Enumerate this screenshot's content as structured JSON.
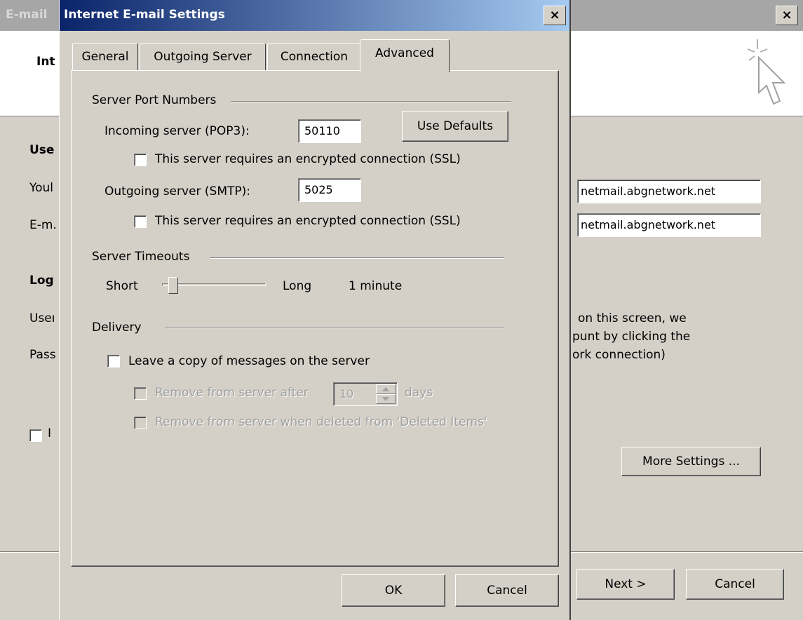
{
  "background_window": {
    "title": "E-mail",
    "header_title": "Int",
    "sections": {
      "user": "Use",
      "logon": "Log"
    },
    "labels": {
      "your": "Youl",
      "email": "E-m.",
      "user": "Useı",
      "pass": "Pass"
    },
    "inputs": {
      "incoming_server": "netmail.abgnetwork.net",
      "outgoing_server": "netmail.abgnetwork.net"
    },
    "info_text": {
      "line1": "on this screen, we",
      "line2": "punt by clicking the",
      "line3": "ork connection)"
    },
    "checkbox_label": "I",
    "buttons": {
      "more_settings": "More Settings ...",
      "next": "Next >",
      "cancel": "Cancel"
    },
    "close_label": "×"
  },
  "dialog": {
    "title": "Internet E-mail Settings",
    "close_label": "×",
    "tabs": [
      {
        "label": "General",
        "active": false
      },
      {
        "label": "Outgoing Server",
        "active": false
      },
      {
        "label": "Connection",
        "active": false
      },
      {
        "label": "Advanced",
        "active": true
      }
    ],
    "port_numbers": {
      "group_title": "Server Port Numbers",
      "incoming_label": "Incoming server (POP3):",
      "incoming_value": "50110",
      "use_defaults": "Use Defaults",
      "ssl_label_incoming": "This server requires an encrypted connection (SSL)",
      "outgoing_label": "Outgoing server (SMTP):",
      "outgoing_value": "5025",
      "ssl_label_outgoing": "This server requires an encrypted connection (SSL)"
    },
    "timeouts": {
      "group_title": "Server Timeouts",
      "short_label": "Short",
      "long_label": "Long",
      "value_text": "1 minute"
    },
    "delivery": {
      "group_title": "Delivery",
      "leave_copy_label": "Leave a copy of messages on the server",
      "remove_after_label": "Remove from server after",
      "remove_after_value": "10",
      "days_label": "days",
      "remove_deleted_label": "Remove from server when deleted from 'Deleted Items'"
    },
    "buttons": {
      "ok": "OK",
      "cancel": "Cancel"
    }
  }
}
